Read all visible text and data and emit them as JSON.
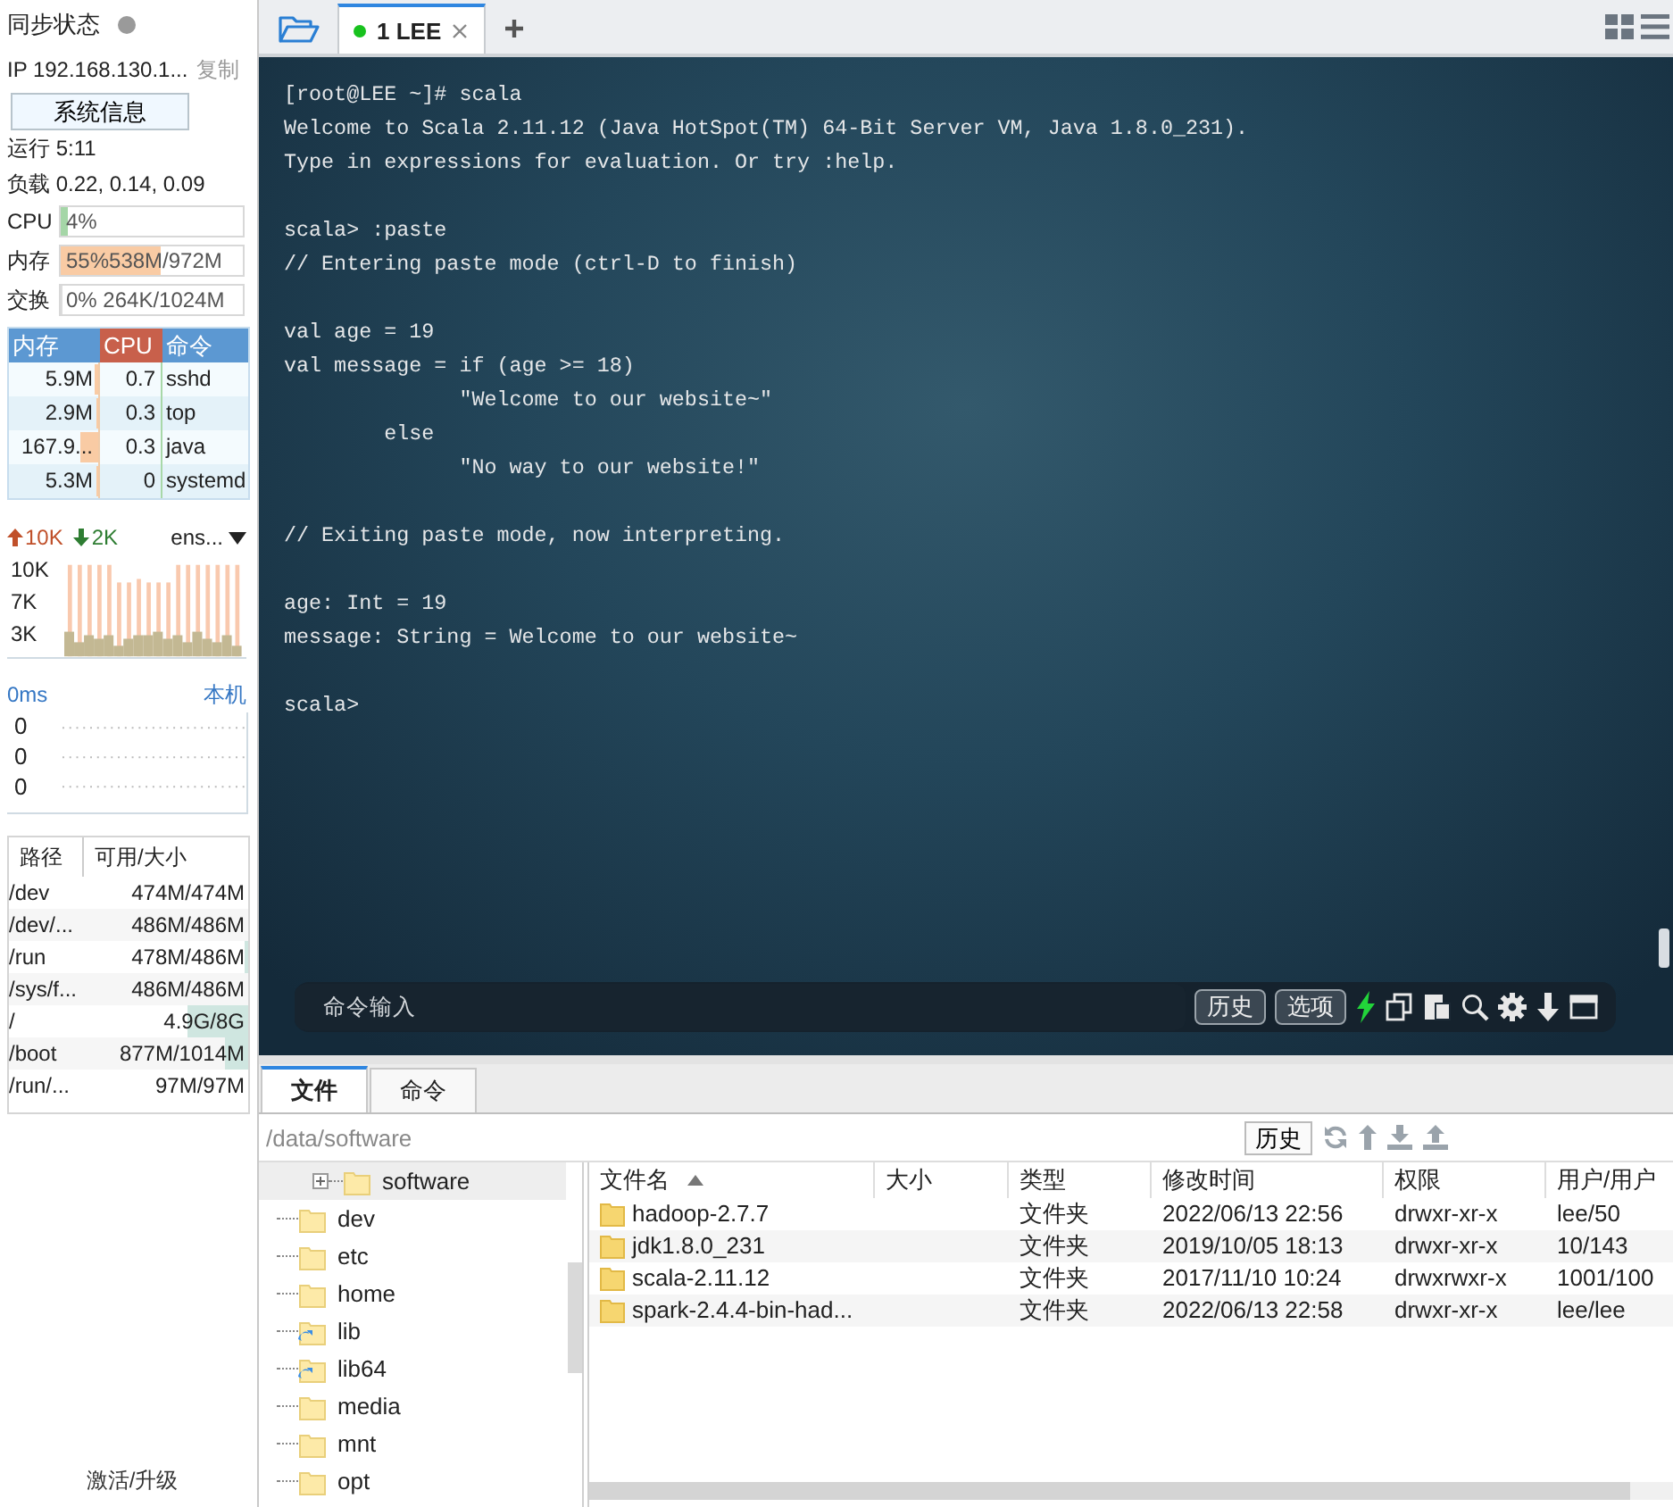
{
  "sidebar": {
    "sync": {
      "label": "同步状态",
      "connected": false
    },
    "ip": {
      "text": "IP 192.168.130.1...",
      "action": "复制"
    },
    "sysinfo_button": "系统信息",
    "uptime": "运行 5:11",
    "load": "负载 0.22, 0.14, 0.09",
    "meters": [
      {
        "label": "CPU",
        "reading": "4%",
        "level": 0.04,
        "color": "#a5d6a7"
      },
      {
        "label": "内存",
        "reading": "55%538M/972M",
        "level": 0.55,
        "color": "#f9cba4"
      },
      {
        "label": "交换",
        "reading": "0% 264K/1024M",
        "level": 0
      }
    ],
    "processes": {
      "columns": [
        {
          "label": "内存",
          "selected": false
        },
        {
          "label": "CPU",
          "selected": true
        },
        {
          "label": "命令",
          "selected": false
        }
      ],
      "rows": [
        {
          "memory": "5.9M",
          "cpu": "0.7",
          "command": "sshd",
          "level": 0.04
        },
        {
          "memory": "2.9M",
          "cpu": "0.3",
          "command": "top",
          "level": 0.02
        },
        {
          "memory": "167.9...",
          "cpu": "0.3",
          "command": "java",
          "level": 0.2
        },
        {
          "memory": "5.3M",
          "cpu": "0",
          "command": "systemd",
          "level": 0.02
        }
      ]
    },
    "network": {
      "up": "10K",
      "down": "2K",
      "interface": "ens...",
      "ticks": [
        "10K",
        "7K",
        "3K"
      ]
    },
    "latency": {
      "reading": "0ms",
      "host": "本机",
      "ticks": [
        "0",
        "0",
        "0"
      ]
    },
    "disks": {
      "columns": [
        "路径",
        "可用/大小"
      ],
      "rows": [
        {
          "path": "/dev",
          "usage": "474M/474M",
          "level": 0
        },
        {
          "path": "/dev/...",
          "usage": "486M/486M",
          "level": 0
        },
        {
          "path": "/run",
          "usage": "478M/486M",
          "level": 0.02
        },
        {
          "path": "/sys/f...",
          "usage": "486M/486M",
          "level": 0
        },
        {
          "path": "/",
          "usage": "4.9G/8G",
          "level": 0.37
        },
        {
          "path": "/boot",
          "usage": "877M/1014M",
          "level": 0.14
        },
        {
          "path": "/run/...",
          "usage": "97M/97M",
          "level": 0
        }
      ]
    },
    "upgrade_link": "激活/升级"
  },
  "tabs": [
    {
      "label": "1 LEE",
      "selected": true,
      "connected": true
    }
  ],
  "terminal": {
    "blocks": [
      [
        "[root@LEE ~]# scala",
        "Welcome to Scala 2.11.12 (Java HotSpot(TM) 64-Bit Server VM, Java 1.8.0_231).",
        "Type in expressions for evaluation. Or try :help."
      ],
      [
        "scala> :paste",
        "// Entering paste mode (ctrl-D to finish)"
      ],
      [
        "val age = 19",
        "val message = if (age >= 18)",
        "              \"Welcome to our website~\"",
        "        else",
        "              \"No way to our website!\""
      ],
      [
        "// Exiting paste mode, now interpreting."
      ],
      [
        "age: Int = 19",
        "message: String = Welcome to our website~"
      ],
      [
        "scala>"
      ]
    ],
    "command_input": {
      "placeholder": "命令输入"
    },
    "buttons": [
      "历史",
      "选项"
    ]
  },
  "bottom_tabs": [
    {
      "label": "文件",
      "selected": true
    },
    {
      "label": "命令",
      "selected": false
    }
  ],
  "file_browser": {
    "path": "/data/software",
    "history_button": "历史",
    "tree": {
      "branch": [
        {
          "label": "software",
          "kind": "folder",
          "selected": true,
          "expanded": false
        }
      ],
      "items": [
        {
          "label": "dev",
          "kind": "folder",
          "selected": false
        },
        {
          "label": "etc",
          "kind": "folder",
          "selected": false
        },
        {
          "label": "home",
          "kind": "folder",
          "selected": false
        },
        {
          "label": "lib",
          "kind": "link",
          "selected": false
        },
        {
          "label": "lib64",
          "kind": "link",
          "selected": false
        },
        {
          "label": "media",
          "kind": "folder",
          "selected": false
        },
        {
          "label": "mnt",
          "kind": "folder",
          "selected": false
        },
        {
          "label": "opt",
          "kind": "folder",
          "selected": false
        }
      ]
    },
    "columns": [
      {
        "label": "文件名",
        "sorted": true
      },
      {
        "label": "大小",
        "sorted": false
      },
      {
        "label": "类型",
        "sorted": false
      },
      {
        "label": "修改时间",
        "sorted": false
      },
      {
        "label": "权限",
        "sorted": false
      },
      {
        "label": "用户/用户",
        "sorted": false
      }
    ],
    "rows": [
      {
        "name": "hadoop-2.7.7",
        "type": "文件夹",
        "modified": "2022/06/13 22:56",
        "permissions": "drwxr-xr-x",
        "owner": "lee/50"
      },
      {
        "name": "jdk1.8.0_231",
        "type": "文件夹",
        "modified": "2019/10/05 18:13",
        "permissions": "drwxr-xr-x",
        "owner": "10/143"
      },
      {
        "name": "scala-2.11.12",
        "type": "文件夹",
        "modified": "2017/11/10 10:24",
        "permissions": "drwxrwxr-x",
        "owner": "1001/100"
      },
      {
        "name": "spark-2.4.4-bin-had...",
        "type": "文件夹",
        "modified": "2022/06/13 22:58",
        "permissions": "drwxr-xr-x",
        "owner": "lee/lee"
      }
    ]
  }
}
